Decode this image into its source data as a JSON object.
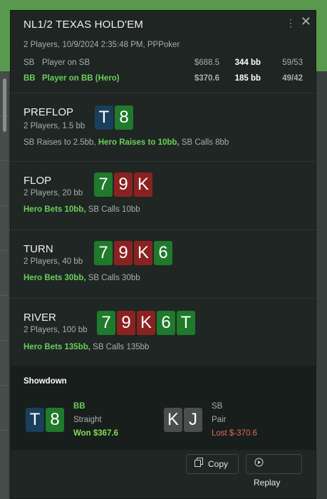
{
  "header": {
    "title": "NL1/2 TEXAS HOLD'EM",
    "subtitle": "2 Players, 10/9/2024 2:35:48 PM, PPPoker",
    "menu_icon": "kebab-menu-icon",
    "close_icon": "close-icon"
  },
  "players": [
    {
      "pos": "SB",
      "name": "Player on SB",
      "stack": "$688.5",
      "bb": "344 bb",
      "ratio": "59/53"
    },
    {
      "pos": "BB",
      "name": "Player on BB (Hero)",
      "stack": "$370.6",
      "bb": "185 bb",
      "ratio": "49/42"
    }
  ],
  "streets": {
    "preflop": {
      "label": "PREFLOP",
      "players": "2 Players, 1.5 bb",
      "cards": [
        "T",
        "8"
      ],
      "a1": "SB Raises to 2.5bb, ",
      "hero": "Hero Raises to 10bb,",
      "a2": " SB Calls 8bb"
    },
    "flop": {
      "label": "FLOP",
      "players": "2 Players, 20 bb",
      "cards": [
        "7",
        "9",
        "K"
      ],
      "hero": "Hero Bets 10bb,",
      "a2": " SB Calls 10bb"
    },
    "turn": {
      "label": "TURN",
      "players": "2 Players, 40 bb",
      "cards": [
        "7",
        "9",
        "K",
        "6"
      ],
      "hero": "Hero Bets 30bb,",
      "a2": " SB Calls 30bb"
    },
    "river": {
      "label": "RIVER",
      "players": "2 Players, 100 bb",
      "cards": [
        "7",
        "9",
        "K",
        "6",
        "T"
      ],
      "hero": "Hero Bets 135bb,",
      "a2": " SB Calls 135bb"
    }
  },
  "showdown": {
    "title": "Showdown",
    "hero": {
      "cards": [
        "T",
        "8"
      ],
      "pos": "BB",
      "hand": "Straight",
      "result": "Won $367.6"
    },
    "villain": {
      "cards": [
        "K",
        "J"
      ],
      "pos": "SB",
      "hand": "Pair",
      "result": "Lost $-370.6"
    }
  },
  "buttons": {
    "copy": "Copy",
    "replay": "Replay",
    "copy_icon": "copy-icon",
    "replay_icon": "replay-icon"
  },
  "colors": {
    "hero_green": "#6ccf58",
    "card_green": "#1f7a2c",
    "card_red": "#8b2222",
    "card_blue": "#1a3f5c",
    "card_gray": "#4a4f4e",
    "loss_red": "#e06a5a"
  }
}
